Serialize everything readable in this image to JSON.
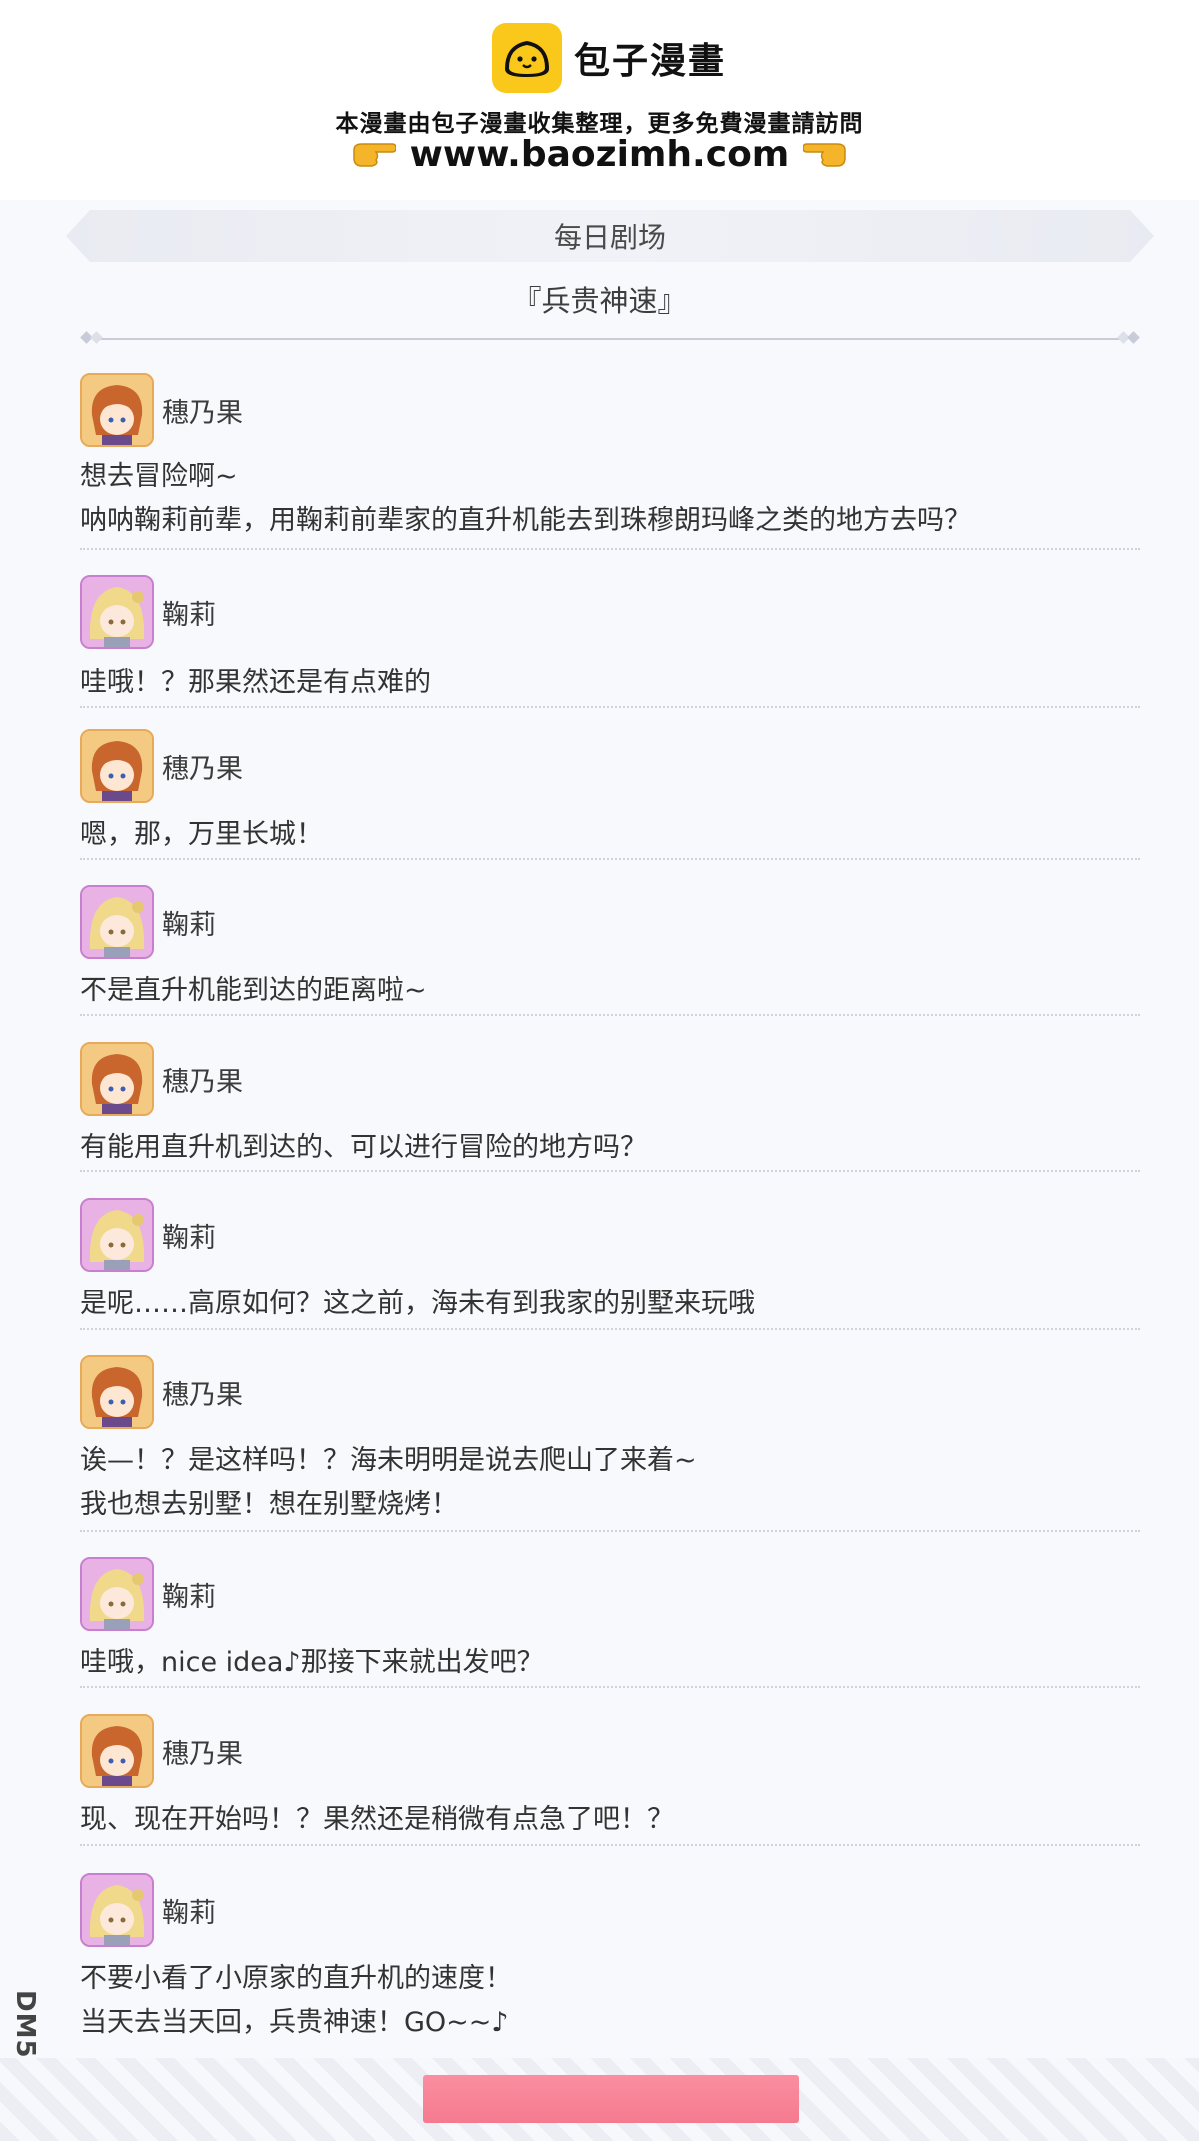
{
  "banner": {
    "brand_name": "包子漫畫",
    "notice": "本漫畫由包子漫畫收集整理，更多免費漫畫請訪問",
    "site": "www.baozimh.com",
    "logo_color": "#f9c81a"
  },
  "panel": {
    "header": "每日剧场",
    "title": "『兵贵神速』"
  },
  "entries": [
    {
      "speaker": "穗乃果",
      "lines": [
        "想去冒险啊~",
        "呐呐鞠莉前辈，用鞠莉前辈家的直升机能去到珠穆朗玛峰之类的地方去吗？"
      ]
    },
    {
      "speaker": "鞠莉",
      "lines": [
        "哇哦！？那果然还是有点难的"
      ]
    },
    {
      "speaker": "穗乃果",
      "lines": [
        "嗯，那，万里长城！"
      ]
    },
    {
      "speaker": "鞠莉",
      "lines": [
        "不是直升机能到达的距离啦~"
      ]
    },
    {
      "speaker": "穗乃果",
      "lines": [
        "有能用直升机到达的、可以进行冒险的地方吗？"
      ]
    },
    {
      "speaker": "鞠莉",
      "lines": [
        "是呢……高原如何？这之前，海未有到我家的别墅来玩哦"
      ]
    },
    {
      "speaker": "穗乃果",
      "lines": [
        "诶—！？是这样吗！？海未明明是说去爬山了来着~",
        "我也想去别墅！想在别墅烧烤！"
      ]
    },
    {
      "speaker": "鞠莉",
      "lines": [
        "哇哦，nice idea♪那接下来就出发吧？"
      ]
    },
    {
      "speaker": "穗乃果",
      "lines": [
        "现、现在开始吗！？果然还是稍微有点急了吧！？"
      ]
    },
    {
      "speaker": "鞠莉",
      "lines": [
        "不要小看了小原家的直升机的速度！",
        "当天去当天回，兵贵神速！GO~~♪"
      ]
    }
  ],
  "watermark": "DM5",
  "colors": {
    "honoka_avatar": "#f4c982",
    "mari_avatar": "#e8b2e4",
    "bottom_bar": "#f57a8f"
  }
}
